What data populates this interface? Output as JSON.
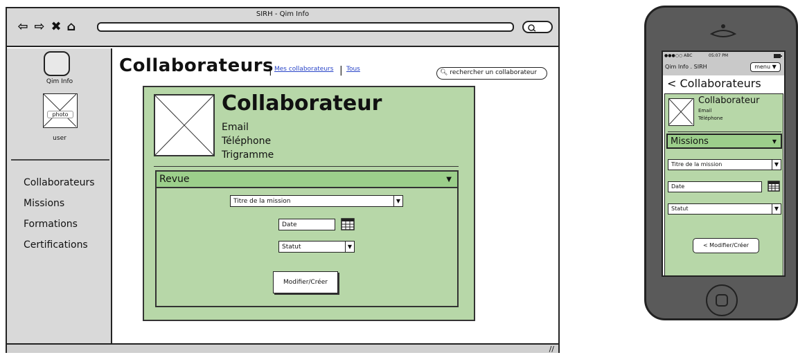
{
  "browser": {
    "title": "SIRH - Qim Info"
  },
  "sidebar": {
    "logo_label": "Qim Info",
    "photo_label": "photo",
    "user_label": "user",
    "items": [
      {
        "label": "Collaborateurs"
      },
      {
        "label": "Missions"
      },
      {
        "label": "Formations"
      },
      {
        "label": "Certifications"
      }
    ]
  },
  "main": {
    "title": "Collaborateurs",
    "separator": "|",
    "link_mes": "Mes collaborateurs",
    "link_tous": "Tous",
    "search_placeholder": "rechercher un collaborateur"
  },
  "card": {
    "name": "Collaborateur",
    "email": "Email",
    "telephone": "Téléphone",
    "trigramme": "Trigramme",
    "section_title": "Revue",
    "mission_placeholder": "Titre de la mission",
    "date_placeholder": "Date",
    "statut_placeholder": "Statut",
    "button_label": "Modifier/Créer"
  },
  "phone": {
    "carrier": "●●●○○ ABC",
    "time": "05:07 PM",
    "app_name": "Qim Info . SIRH",
    "menu_label": "menu ▼",
    "back_title": "< Collaborateurs",
    "name": "Collaborateur",
    "email": "Email",
    "telephone": "Téléphone",
    "section_title": "Missions",
    "mission_placeholder": "Titre de la mission",
    "date_placeholder": "Date",
    "statut_placeholder": "Statut",
    "button_label": "< Modifier/Créer"
  },
  "colors": {
    "card_green": "#b7d7a8",
    "header_green": "#9ccf8b",
    "chrome_gray": "#d8d8d8",
    "link_blue": "#2844c8"
  },
  "icons": [
    "back-arrow-icon",
    "forward-arrow-icon",
    "close-icon",
    "home-icon",
    "search-icon",
    "calendar-icon",
    "chevron-down-icon",
    "battery-icon"
  ]
}
